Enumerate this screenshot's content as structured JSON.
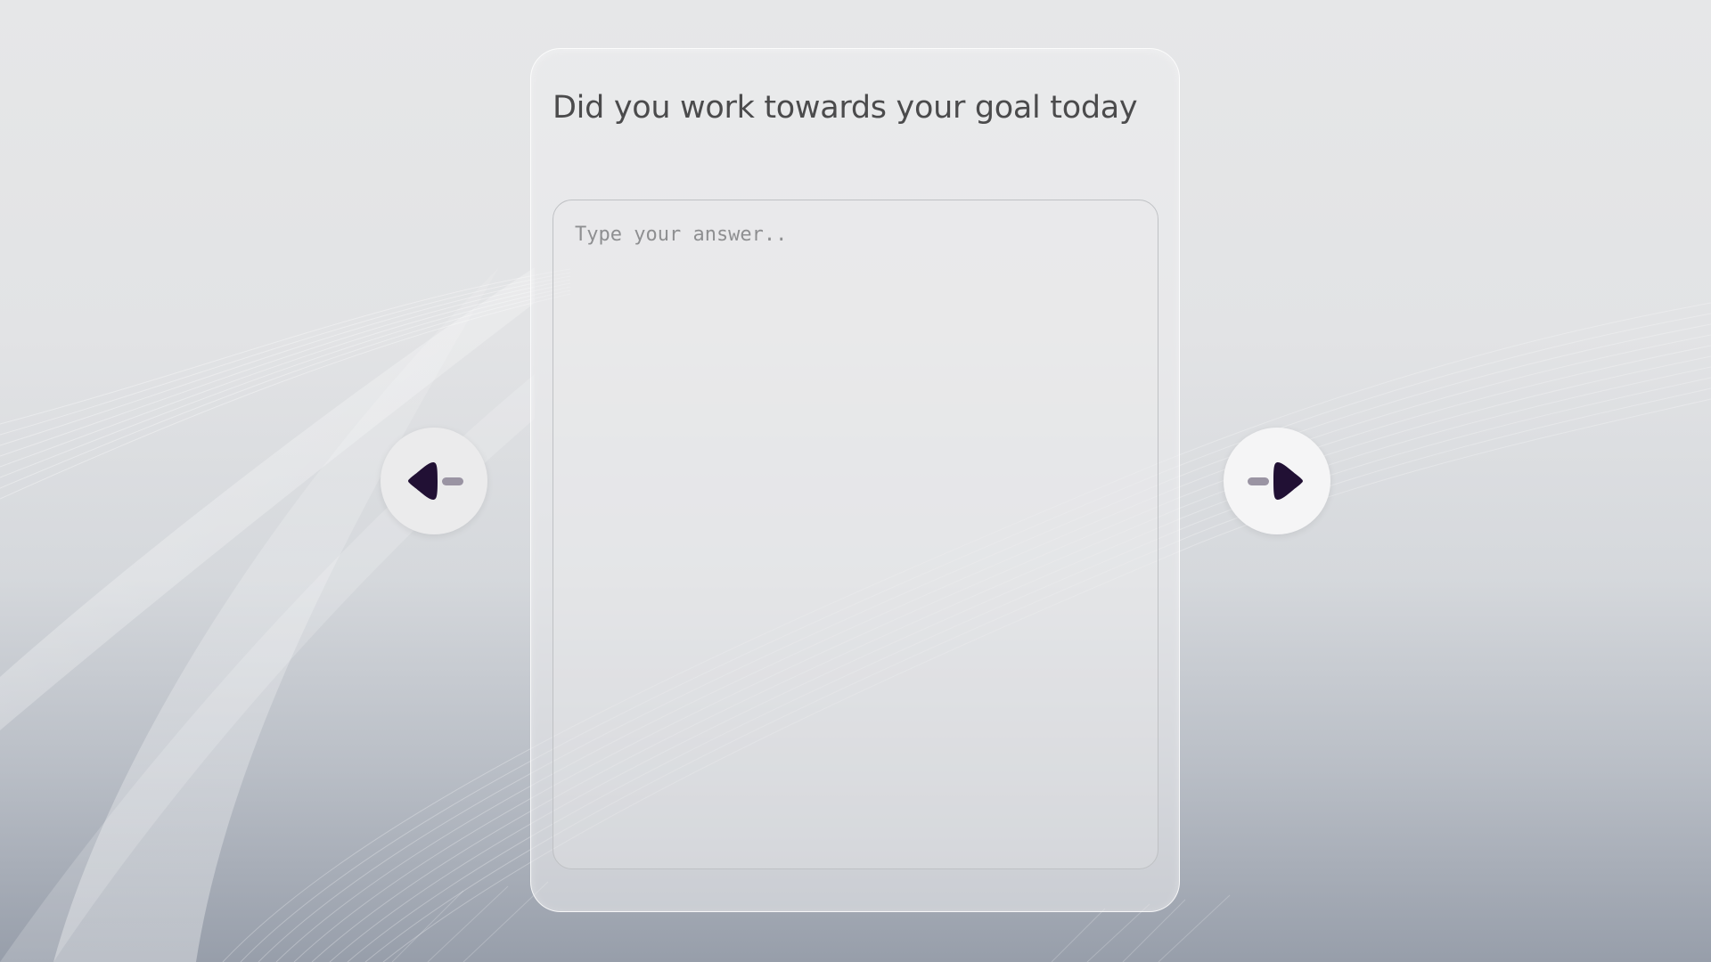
{
  "form": {
    "question": "Did you work towards your goal today",
    "answer_placeholder": "Type your answer..",
    "answer_value": ""
  },
  "navigation": {
    "previous_icon": "arrow-left-icon",
    "next_icon": "arrow-right-icon"
  },
  "colors": {
    "icon_dark": "#211034",
    "icon_bar": "#9a94a3",
    "question_text": "#4b4b4c",
    "card_border": "#ffffff"
  }
}
